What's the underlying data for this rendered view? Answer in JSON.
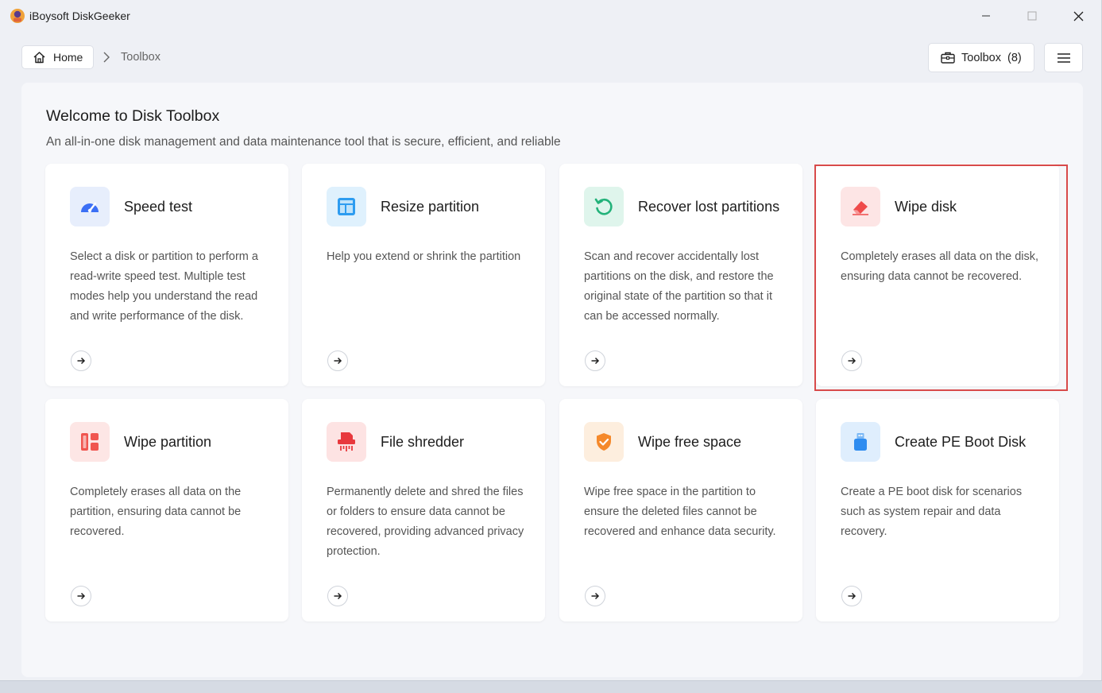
{
  "app": {
    "title": "iBoysoft DiskGeeker"
  },
  "nav": {
    "home_label": "Home",
    "breadcrumb_current": "Toolbox",
    "toolbox_label": "Toolbox",
    "toolbox_count": "(8)"
  },
  "page": {
    "title": "Welcome to Disk Toolbox",
    "subtitle": "An all-in-one disk management and data maintenance tool that is secure, efficient, and reliable"
  },
  "cards": [
    {
      "title": "Speed test",
      "desc": "Select a disk or partition to perform a read-write speed test. Multiple test modes help you understand the read and write performance of the disk.",
      "icon": "speedometer-icon",
      "color": "#3b6ff5",
      "bg": "#e7eefc"
    },
    {
      "title": "Resize partition",
      "desc": "Help you extend or shrink the partition",
      "icon": "layout-icon",
      "color": "#2d9cf0",
      "bg": "#dff1fd"
    },
    {
      "title": "Recover lost partitions",
      "desc": "Scan and recover accidentally lost partitions on the disk, and restore the original state of the partition so that it can be accessed normally.",
      "icon": "restore-icon",
      "color": "#23b27a",
      "bg": "#dff5ec"
    },
    {
      "title": "Wipe disk",
      "desc": "Completely erases all data on the disk, ensuring data cannot be recovered.",
      "icon": "eraser-icon",
      "color": "#ef4b4b",
      "bg": "#fde5e5"
    },
    {
      "title": "Wipe partition",
      "desc": "Completely erases all data on the partition, ensuring data cannot be recovered.",
      "icon": "partition-icon",
      "color": "#f0554f",
      "bg": "#fde6e5"
    },
    {
      "title": "File shredder",
      "desc": "Permanently delete and shred the files or folders to ensure data cannot be recovered, providing advanced privacy protection.",
      "icon": "shredder-icon",
      "color": "#e8383d",
      "bg": "#fde3e3"
    },
    {
      "title": "Wipe free space",
      "desc": "Wipe free space in the partition to ensure the deleted files cannot be recovered and enhance data security.",
      "icon": "shield-icon",
      "color": "#f5892b",
      "bg": "#fdeede"
    },
    {
      "title": "Create PE Boot Disk",
      "desc": "Create a PE boot disk for scenarios such as system repair and data recovery.",
      "icon": "usb-drive-icon",
      "color": "#2e8cf0",
      "bg": "#dfeefd"
    }
  ]
}
